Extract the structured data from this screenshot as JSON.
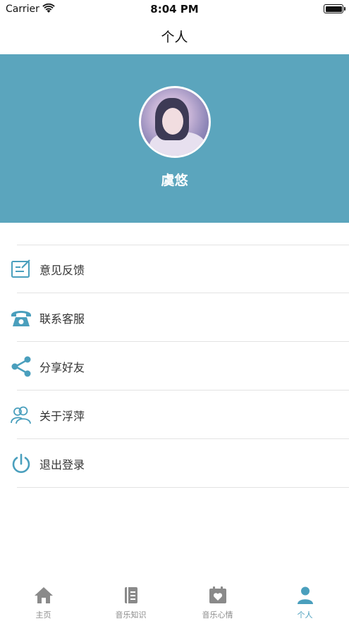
{
  "status_bar": {
    "carrier": "Carrier",
    "time": "8:04 PM"
  },
  "nav": {
    "title": "个人"
  },
  "profile": {
    "username": "虞悠"
  },
  "menu": {
    "items": [
      {
        "label": "意见反馈",
        "icon": "feedback-edit-icon"
      },
      {
        "label": "联系客服",
        "icon": "telephone-icon"
      },
      {
        "label": "分享好友",
        "icon": "share-icon"
      },
      {
        "label": "关于浮萍",
        "icon": "users-about-icon"
      },
      {
        "label": "退出登录",
        "icon": "power-icon"
      }
    ]
  },
  "tab_bar": {
    "tabs": [
      {
        "label": "主页",
        "icon": "home-icon"
      },
      {
        "label": "音乐知识",
        "icon": "book-icon"
      },
      {
        "label": "音乐心情",
        "icon": "calendar-heart-icon"
      },
      {
        "label": "个人",
        "icon": "person-icon",
        "active": true
      }
    ]
  },
  "colors": {
    "accent": "#5ba5bd",
    "icon": "#4a9fbd",
    "inactive": "#8a8a8a"
  }
}
